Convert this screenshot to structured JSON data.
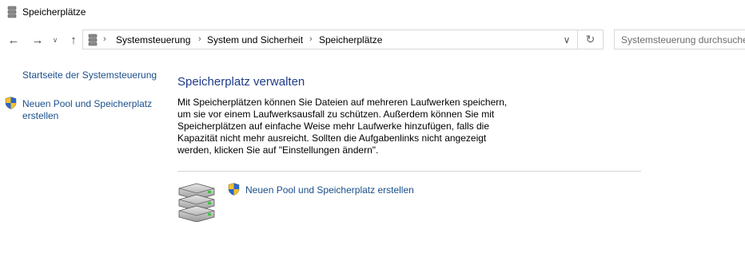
{
  "window": {
    "title": "Speicherplätze",
    "icon": "storage-spaces-icon"
  },
  "navigation": {
    "back_icon": "arrow-left-icon",
    "forward_icon": "arrow-right-icon",
    "recent_icon": "chevron-down-icon",
    "up_icon": "arrow-up-icon",
    "address_icon": "storage-spaces-icon",
    "breadcrumb": [
      "Systemsteuerung",
      "System und Sicherheit",
      "Speicherplätze"
    ],
    "separator": "›",
    "dropdown_icon": "chevron-down-icon",
    "refresh_icon": "refresh-icon"
  },
  "search": {
    "placeholder": "Systemsteuerung durchsuchen"
  },
  "sidebar": {
    "home_link": "Startseite der Systemsteuerung",
    "new_pool_link_line1": "Neuen Pool und Speicherplatz",
    "new_pool_link_line2": "erstellen",
    "shield_icon": "uac-shield-icon"
  },
  "main": {
    "title": "Speicherplatz verwalten",
    "description_lines": [
      "Mit Speicherplätzen können Sie Dateien auf mehreren Laufwerken speichern,",
      "um sie vor einem Laufwerksausfall zu schützen. Außerdem können Sie mit",
      "Speicherplätzen auf einfache Weise mehr Laufwerke hinzufügen, falls die",
      "Kapazität nicht mehr ausreicht. Sollten die Aufgabenlinks nicht angezeigt",
      "werden, klicken Sie auf \"Einstellungen ändern\"."
    ],
    "task_link": "Neuen Pool und Speicherplatz erstellen",
    "drives_icon": "stacked-drives-icon"
  },
  "colors": {
    "link": "#1a4f8c",
    "title": "#1e3b8a",
    "border": "#d9d9d9"
  }
}
